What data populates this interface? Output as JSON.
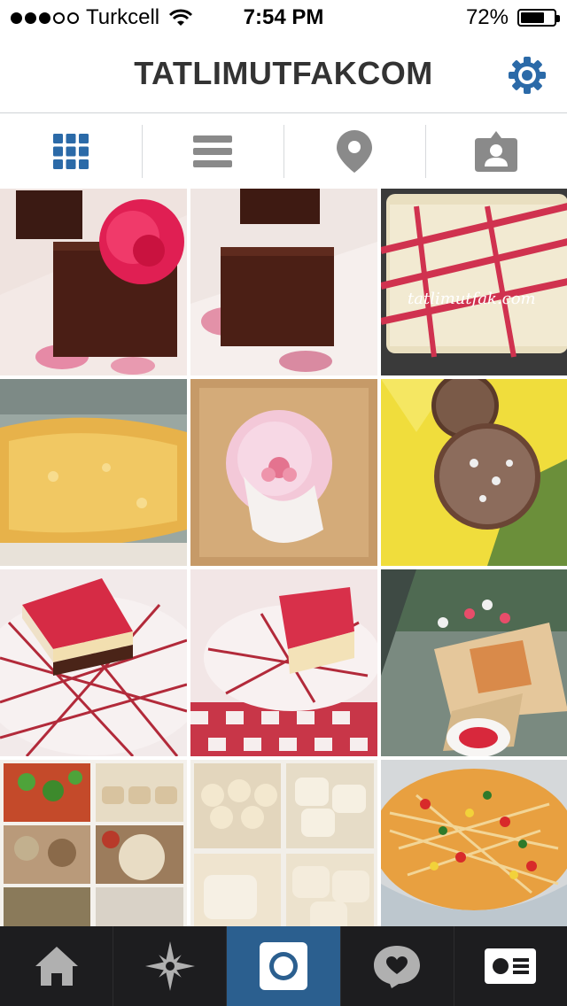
{
  "status_bar": {
    "carrier": "Turkcell",
    "time": "7:54 PM",
    "battery_percent": "72%",
    "battery_level": 0.72,
    "signal_bars_filled": 3,
    "signal_bars_total": 5
  },
  "header": {
    "title": "TATLIMUTFAKCOM",
    "settings_icon": "gear-icon"
  },
  "view_tabs": [
    {
      "name": "grid-view",
      "icon": "grid-icon",
      "active": true
    },
    {
      "name": "list-view",
      "icon": "list-icon",
      "active": false
    },
    {
      "name": "map-view",
      "icon": "location-pin-icon",
      "active": false
    },
    {
      "name": "tagged-view",
      "icon": "person-tag-icon",
      "active": false
    }
  ],
  "photos": [
    {
      "name": "photo-brownie-with-flower"
    },
    {
      "name": "photo-brownie-on-plate"
    },
    {
      "name": "photo-baked-dessert-tray",
      "watermark": "tatlimutfak.com"
    },
    {
      "name": "photo-cornbread"
    },
    {
      "name": "photo-pink-tulle-favor"
    },
    {
      "name": "photo-coconut-truffles"
    },
    {
      "name": "photo-cheesecake-slice-1"
    },
    {
      "name": "photo-cheesecake-slice-2"
    },
    {
      "name": "photo-picnic-snack"
    },
    {
      "name": "photo-collage-food"
    },
    {
      "name": "photo-collage-buns"
    },
    {
      "name": "photo-pasta-salad"
    }
  ],
  "tabbar": [
    {
      "name": "home",
      "icon": "home-icon",
      "active": false
    },
    {
      "name": "explore",
      "icon": "star-compass-icon",
      "active": false
    },
    {
      "name": "camera",
      "icon": "camera-icon",
      "active": true
    },
    {
      "name": "activity",
      "icon": "heart-bubble-icon",
      "active": false
    },
    {
      "name": "profile",
      "icon": "profile-card-icon",
      "active": false
    }
  ],
  "colors": {
    "accent": "#2b6aa8",
    "tabbar_bg": "#1d1d1f",
    "tabbar_active": "#2b5f8f",
    "icon_gray": "#7a7a7a"
  }
}
